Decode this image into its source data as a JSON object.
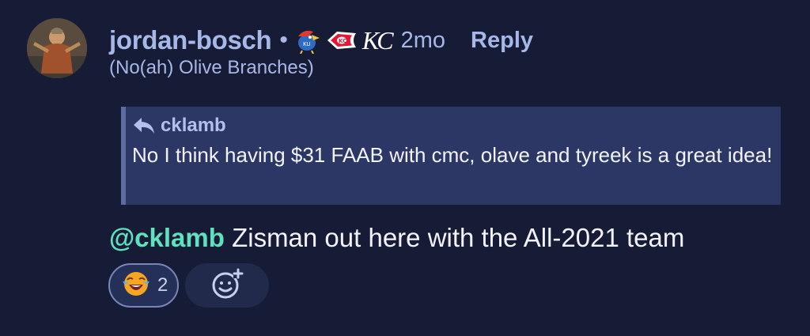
{
  "comment": {
    "username": "jordan-bosch",
    "separator": "•",
    "flairs": [
      "kansas-jayhawks-icon",
      "chiefs-arrowhead-icon",
      "kc-royals-icon"
    ],
    "flair_text": "KC",
    "timestamp": "2mo",
    "reply_label": "Reply",
    "subtitle": "(No(ah) Olive Branches)",
    "quote": {
      "author": "cklamb",
      "text": "No I think having $31 FAAB with cmc, olave and tyreek is a great idea!"
    },
    "body": {
      "mention": "@cklamb",
      "text": " Zisman out here with the All-2021 team"
    },
    "reactions": [
      {
        "icon": "laughing-crying-emoji-icon",
        "count": "2"
      }
    ],
    "add_reaction_icon": "add-reaction-icon"
  },
  "colors": {
    "background": "#161c35",
    "username": "#a7b7e8",
    "mention": "#5fe0be",
    "quote_background": "#2c3766"
  }
}
